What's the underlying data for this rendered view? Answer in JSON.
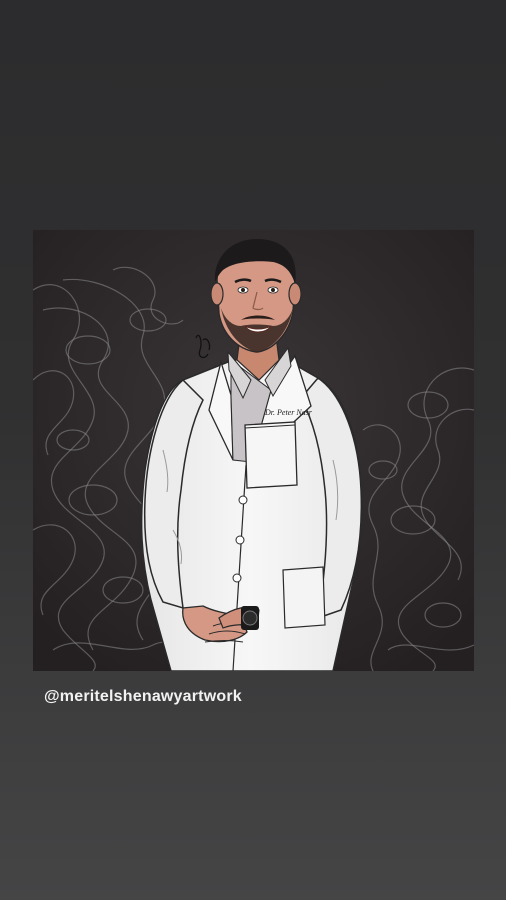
{
  "story": {
    "mention_text": "@meritelshenawyartwork",
    "artwork": {
      "coat_pocket_text": "Dr. Peter Nasr"
    }
  },
  "colors": {
    "background_top": "#2c2c2e",
    "background_bottom": "#454546",
    "artwork_background": "#2a2628",
    "smoke_pattern": "#8a8a8c",
    "lab_coat": "#f4f4f4",
    "skin": "#d49884",
    "hair": "#1c1a1a",
    "mention_text": "#f2f2f2"
  }
}
